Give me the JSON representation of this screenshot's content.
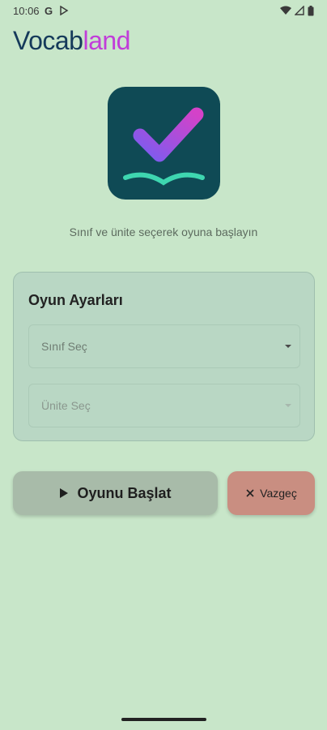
{
  "status_bar": {
    "time": "10:06",
    "left_icons": [
      "google-icon",
      "play-store-icon"
    ],
    "right_icons": [
      "wifi-icon",
      "signal-icon",
      "battery-icon"
    ]
  },
  "app": {
    "title_part_1": "Vocab",
    "title_part_2": "land",
    "title_colors": {
      "part_1": "#153a5a",
      "part_2": "#c13dd9"
    },
    "logo_icon": "checkmark-book-icon"
  },
  "subtitle": "Sınıf ve ünite seçerek oyuna başlayın",
  "settings": {
    "title": "Oyun Ayarları",
    "class_select": {
      "placeholder": "Sınıf Seç",
      "icon": "chevron-down-icon"
    },
    "unit_select": {
      "placeholder": "Ünite Seç",
      "icon": "chevron-down-icon"
    }
  },
  "actions": {
    "start_label": "Oyunu Başlat",
    "start_icon": "play-icon",
    "cancel_label": "Vazgeç",
    "cancel_icon": "close-icon"
  },
  "colors": {
    "background": "#c8e6c9",
    "logo_bg": "#0f4a55",
    "start_button": "#a8bba9",
    "cancel_button": "#c98e81"
  }
}
